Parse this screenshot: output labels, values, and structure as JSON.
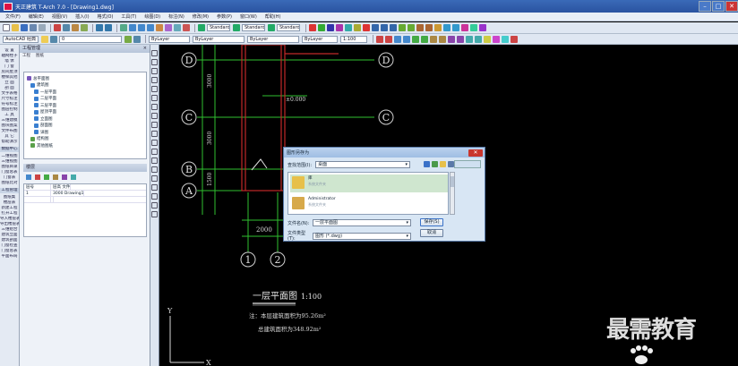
{
  "window": {
    "title": "天正建筑 T-Arch 7.0 - [Drawing1.dwg]",
    "controls": [
      "–",
      "□",
      "✕"
    ]
  },
  "menubar": {
    "items": [
      "文件(F)",
      "编辑(E)",
      "视图(V)",
      "插入(I)",
      "格式(O)",
      "工具(T)",
      "绘图(D)",
      "标注(N)",
      "修改(M)",
      "参数(P)",
      "窗口(W)",
      "帮助(H)"
    ]
  },
  "toolbar": {
    "layer_combo": "0",
    "linetype_combo_1": "ByLayer",
    "linetype_combo_2": "ByLayer",
    "lineweight_combo": "ByLayer",
    "color_combo": "ByLayer",
    "style_combo_1": "Standard",
    "style_combo_2": "Standard",
    "style_combo_3": "Standard",
    "scale_combo": "1:100",
    "workspace_combo": "AutoCAD 经典"
  },
  "left_strip": {
    "items": [
      "设 置",
      "轴网柱子",
      "墙 体",
      "门 窗",
      "房间屋顶",
      "楼梯其他",
      "立 面",
      "剖 面",
      "文字表格",
      "尺寸标注",
      "符号标注",
      "图层控制",
      "工 具",
      "三维建模",
      "图块图案",
      "文件布图",
      "其 它",
      "帮助演示",
      "数据中心",
      "二维视图",
      "三维视图",
      "图纸目录",
      "门窗总表",
      "门窗表",
      "图纸比对",
      "工程管理",
      "图纸集",
      "楼层表",
      "新建工程",
      "打开工程",
      "导入楼层表",
      "导出楼层表",
      "三维组合",
      "建筑立面",
      "建筑剖面",
      "门窗检查",
      "门窗总表",
      "平面布局"
    ]
  },
  "project_panel": {
    "title": "工程管理",
    "close": "×",
    "tabs": [
      "工程",
      "图纸"
    ],
    "tree": [
      "总平面图",
      "建筑图",
      "一层平面",
      "二层平面",
      "三层平面",
      "屋顶平面",
      "立面图",
      "剖面图",
      "详图",
      "结构图",
      "其他图纸"
    ]
  },
  "prop_panel": {
    "title": "楼层",
    "rows": [
      [
        "层号",
        "层高 文件"
      ],
      [
        "1",
        "3000 Drawing1"
      ],
      [
        "",
        ""
      ]
    ]
  },
  "drawing": {
    "axis_labels": [
      "D",
      "C",
      "B",
      "A",
      "1",
      "2"
    ],
    "dimensions": [
      "3000",
      "3000",
      "3000",
      "1500",
      "2000"
    ],
    "elevation_marker": "±0.000",
    "plan_title": "一层平面图",
    "plan_scale": "1:100",
    "area_note_1": "注：本层建筑面积为95.26m²",
    "area_note_2": "总建筑面积为348.92m²",
    "ucs_y": "Y",
    "ucs_x": "X"
  },
  "dialog": {
    "title": "图形另存为",
    "close": "✕",
    "lookin_label": "查找范围(I):",
    "lookin_value": "桌面",
    "files": [
      {
        "name": "库",
        "sub": "系统文件夹"
      },
      {
        "name": "Administrator",
        "sub": "系统文件夹"
      }
    ],
    "filename_label": "文件名(N):",
    "filename_value": "一层平面图",
    "filetype_label": "文件类型(T):",
    "filetype_value": "图形 (*.dwg)",
    "save_button": "保存(S)",
    "cancel_button": "取消"
  },
  "watermark": "最需教育"
}
